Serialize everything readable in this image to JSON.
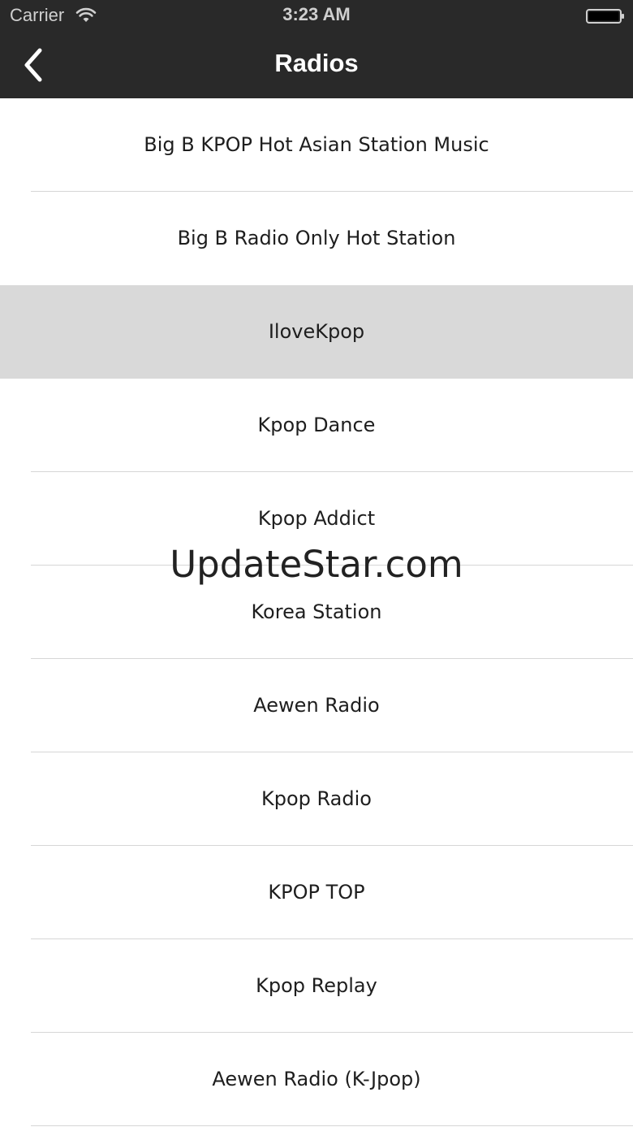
{
  "status_bar": {
    "carrier": "Carrier",
    "time": "3:23 AM",
    "wifi_icon": "wifi-icon",
    "battery_icon": "battery-icon"
  },
  "nav": {
    "title": "Radios",
    "back_icon": "chevron-left-icon"
  },
  "colors": {
    "nav_background": "#292929",
    "selected_row": "#d9d9d9",
    "separator": "#d6d6d6",
    "text": "#1e1e1e"
  },
  "stations": [
    {
      "label": "Big B KPOP Hot Asian Station Music",
      "selected": false
    },
    {
      "label": "Big B Radio Only Hot Station",
      "selected": false
    },
    {
      "label": "IloveKpop",
      "selected": true
    },
    {
      "label": "Kpop Dance",
      "selected": false
    },
    {
      "label": "Kpop Addict",
      "selected": false
    },
    {
      "label": "Korea Station",
      "selected": false
    },
    {
      "label": "Aewen Radio",
      "selected": false
    },
    {
      "label": "Kpop Radio",
      "selected": false
    },
    {
      "label": "KPOP TOP",
      "selected": false
    },
    {
      "label": "Kpop Replay",
      "selected": false
    },
    {
      "label": "Aewen Radio (K-Jpop)",
      "selected": false
    }
  ],
  "watermark": "UpdateStar.com"
}
